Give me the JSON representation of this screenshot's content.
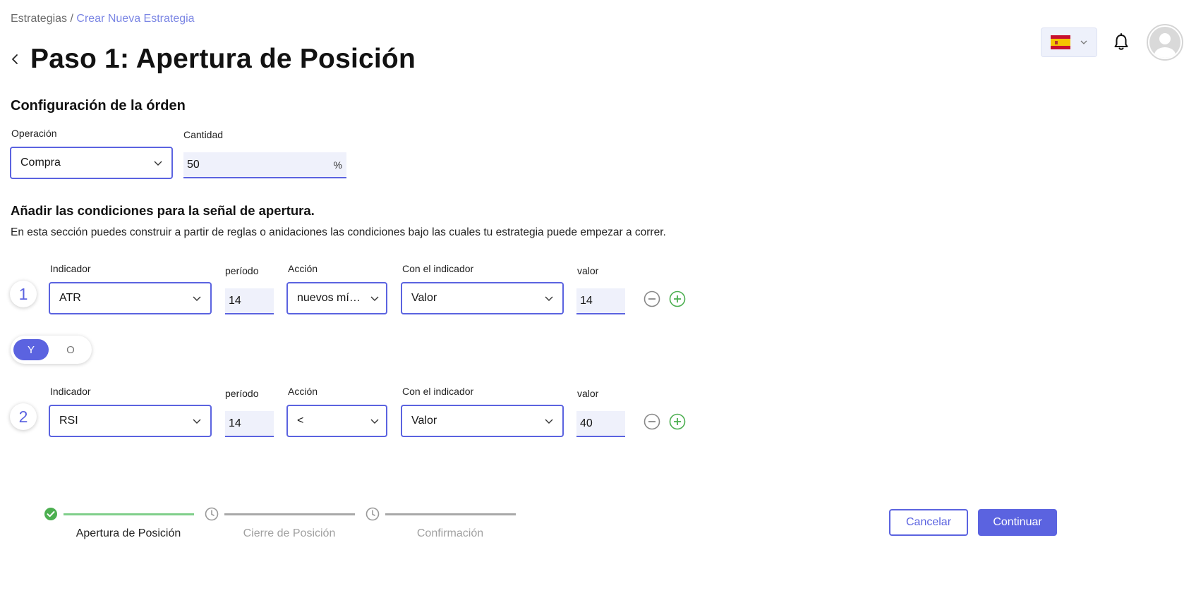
{
  "breadcrumb": {
    "parent": "Estrategias",
    "separator": " / ",
    "current": "Crear Nueva Estrategia"
  },
  "page_title": "Paso 1: Apertura de Posición",
  "header": {
    "language_flag": "spain-flag-icon",
    "notification_icon": "bell-icon",
    "avatar_icon": "user-avatar-icon"
  },
  "order_config": {
    "title": "Configuración de la órden",
    "operation": {
      "label": "Operación",
      "value": "Compra"
    },
    "quantity": {
      "label": "Cantidad",
      "value": "50",
      "suffix": "%"
    }
  },
  "conditions": {
    "title": "Añadir las condiciones para la señal de apertura.",
    "description": "En esta sección puedes construir a partir de reglas o anidaciones las condiciones bajo las cuales tu estrategia puede empezar a correr.",
    "rows": [
      {
        "number": "1",
        "indicator_label": "Indicador",
        "indicator": "ATR",
        "period_label": "período",
        "period": "14",
        "action_label": "Acción",
        "action": "nuevos míni...",
        "compare_label": "Con el indicador",
        "compare": "Valor",
        "value_label": "valor",
        "value": "14"
      },
      {
        "number": "2",
        "indicator_label": "Indicador",
        "indicator": "RSI",
        "period_label": "período",
        "period": "14",
        "action_label": "Acción",
        "action": "<",
        "compare_label": "Con el indicador",
        "compare": "Valor",
        "value_label": "valor",
        "value": "40"
      }
    ],
    "logic_toggle": {
      "and": "Y",
      "or": "O",
      "selected": "Y"
    }
  },
  "stepper": {
    "steps": [
      {
        "label": "Apertura de Posición",
        "status": "completed"
      },
      {
        "label": "Cierre de Posición",
        "status": "pending"
      },
      {
        "label": "Confirmación",
        "status": "pending"
      }
    ]
  },
  "actions": {
    "cancel": "Cancelar",
    "continue": "Continuar"
  },
  "colors": {
    "accent": "#5b63e0",
    "success": "#4caf50",
    "muted": "#a9a9a9",
    "breadcrumb_link": "#7b86e4"
  }
}
